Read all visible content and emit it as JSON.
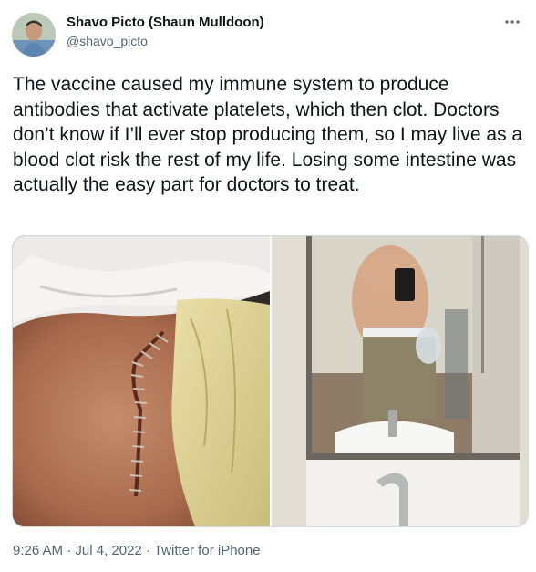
{
  "author": {
    "display_name": "Shavo Picto (Shaun Mulldoon)",
    "handle": "@shavo_picto"
  },
  "more_icon": "more-horizontal-icon",
  "tweet_text": "The vaccine caused my immune system to produce antibodies that activate platelets, which then clot. Doctors don’t know if I’ll ever stop producing them, so I may live as a blood clot risk the rest of my life. Losing some intestine was actually the easy part for doctors to treat.",
  "media": {
    "count": 2
  },
  "meta": {
    "time": "9:26 AM",
    "sep": " · ",
    "date": "Jul 4, 2022",
    "source": "Twitter for iPhone"
  },
  "colors": {
    "text_primary": "#0f1419",
    "text_secondary": "#536471",
    "border": "#cfd9de"
  }
}
